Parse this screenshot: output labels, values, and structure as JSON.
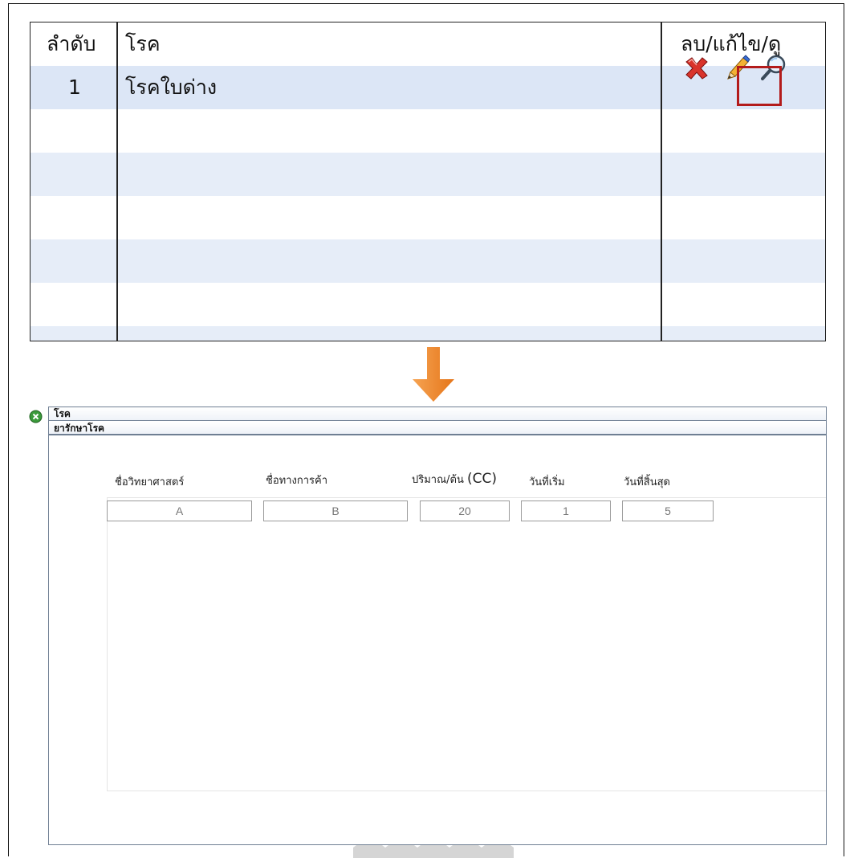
{
  "table": {
    "headers": {
      "index": "ลำดับ",
      "disease": "โรค",
      "actions": "ลบ/แก้ไข/ดู"
    },
    "rows": [
      {
        "index": "1",
        "disease": "โรคใบด่าง"
      }
    ],
    "action_icons": [
      "delete-icon",
      "edit-icon",
      "view-icon"
    ]
  },
  "panel": {
    "title": "โรค",
    "section_title": "ยารักษาโรค",
    "labels": {
      "scientific_name": "ชื่อวิทยาศาสตร์",
      "trade_name": "ชื่อทางการค้า",
      "amount_prefix": "ปริมาณ/ต้น",
      "amount_unit": "(CC)",
      "start_date": "วันที่เริ่ม",
      "end_date": "วันที่สิ้นสุด"
    },
    "values": {
      "scientific_name": "A",
      "trade_name": "B",
      "amount": "20",
      "start_date": "1",
      "end_date": "5"
    }
  },
  "colors": {
    "row_highlight": "#dce6f6",
    "row_alt": "#e6edf8",
    "highlight_border": "#b31b1b",
    "arrow": "#f08a24",
    "status_dot": "#3a9a3a"
  }
}
